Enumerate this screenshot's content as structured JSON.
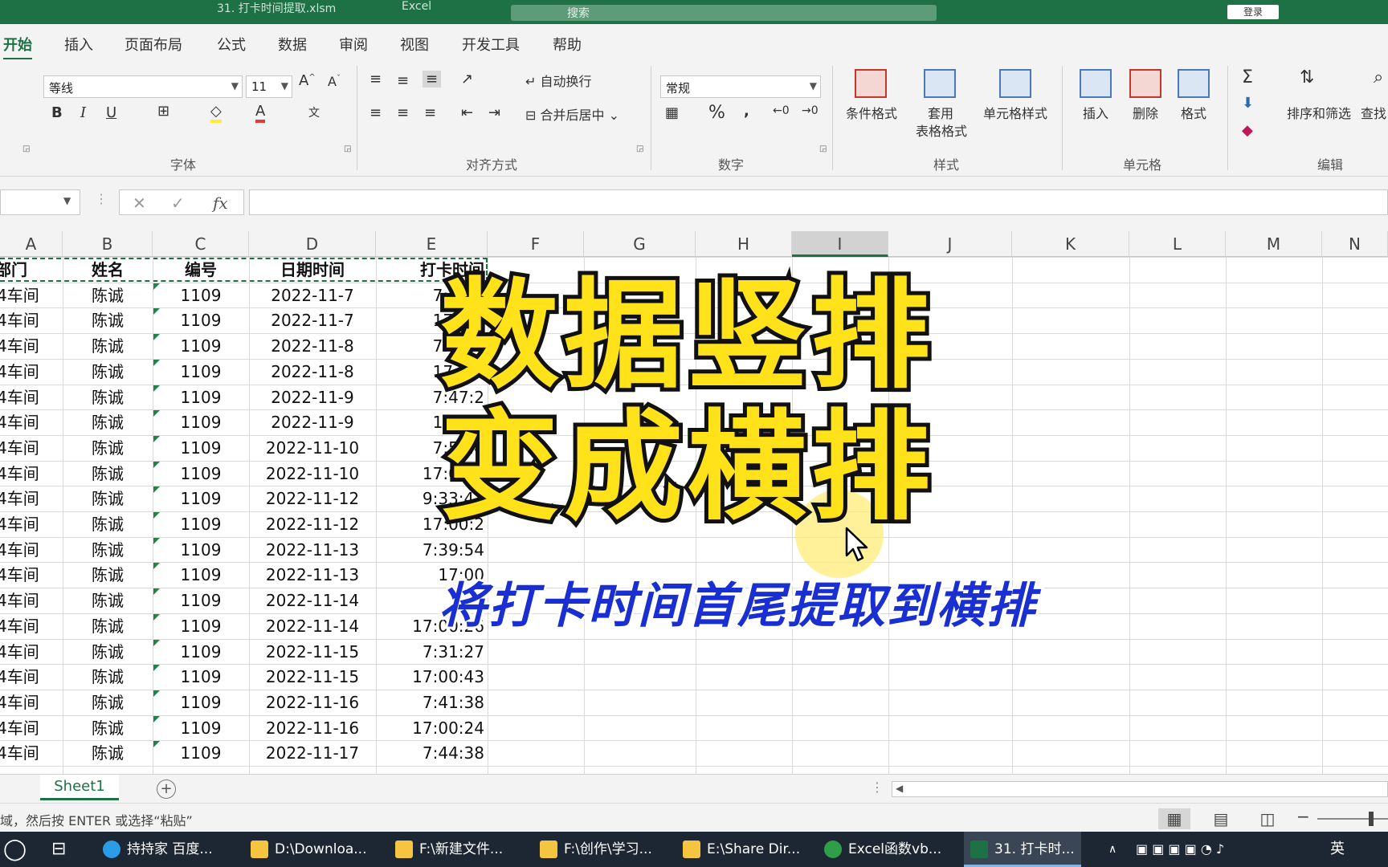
{
  "titlebar": {
    "filename": "31. 打卡时间提取.xlsm",
    "app": "Excel",
    "search": "搜索",
    "login": "登录"
  },
  "tabs": [
    "开始",
    "插入",
    "页面布局",
    "公式",
    "数据",
    "审阅",
    "视图",
    "开发工具",
    "帮助"
  ],
  "ribbon": {
    "font": {
      "name": "等线",
      "size": "11",
      "group_label": "字体"
    },
    "align": {
      "wrap": "自动换行",
      "merge": "合并后居中",
      "group_label": "对齐方式"
    },
    "number": {
      "format": "常规",
      "group_label": "数字"
    },
    "styles": {
      "cond": "条件格式",
      "table_1": "套用",
      "table_2": "表格格式",
      "cell_style": "单元格样式",
      "group_label": "样式"
    },
    "cells": {
      "insert": "插入",
      "delete": "删除",
      "format": "格式",
      "group_label": "单元格"
    },
    "editing": {
      "sort": "排序和筛选",
      "find": "查找",
      "group_label": "编辑"
    }
  },
  "formula_bar": {
    "cancel": "✕",
    "enter": "✓",
    "fx": "fx",
    "value": ""
  },
  "columns": [
    "A",
    "B",
    "C",
    "D",
    "E",
    "F",
    "G",
    "H",
    "I",
    "J",
    "K",
    "L",
    "M",
    "N"
  ],
  "table": {
    "headers": [
      "部门",
      "姓名",
      "编号",
      "日期时间",
      "打卡时间"
    ],
    "rows": [
      [
        "4车间",
        "陈诚",
        "1109",
        "2022-11-7",
        "7:52:3"
      ],
      [
        "4车间",
        "陈诚",
        "1109",
        "2022-11-7",
        "17:00:"
      ],
      [
        "4车间",
        "陈诚",
        "1109",
        "2022-11-8",
        "7:05:0"
      ],
      [
        "4车间",
        "陈诚",
        "1109",
        "2022-11-8",
        "17:09:"
      ],
      [
        "4车间",
        "陈诚",
        "1109",
        "2022-11-9",
        "7:47:2"
      ],
      [
        "4车间",
        "陈诚",
        "1109",
        "2022-11-9",
        "17:03:"
      ],
      [
        "4车间",
        "陈诚",
        "1109",
        "2022-11-10",
        "7:52:4"
      ],
      [
        "4车间",
        "陈诚",
        "1109",
        "2022-11-10",
        "17:01:1"
      ],
      [
        "4车间",
        "陈诚",
        "1109",
        "2022-11-12",
        "9:33:43"
      ],
      [
        "4车间",
        "陈诚",
        "1109",
        "2022-11-12",
        "17:00:2"
      ],
      [
        "4车间",
        "陈诚",
        "1109",
        "2022-11-13",
        "7:39:54"
      ],
      [
        "4车间",
        "陈诚",
        "1109",
        "2022-11-13",
        "17:00"
      ],
      [
        "4车间",
        "陈诚",
        "1109",
        "2022-11-14",
        "7:26"
      ],
      [
        "4车间",
        "陈诚",
        "1109",
        "2022-11-14",
        "17:00:26"
      ],
      [
        "4车间",
        "陈诚",
        "1109",
        "2022-11-15",
        "7:31:27"
      ],
      [
        "4车间",
        "陈诚",
        "1109",
        "2022-11-15",
        "17:00:43"
      ],
      [
        "4车间",
        "陈诚",
        "1109",
        "2022-11-16",
        "7:41:38"
      ],
      [
        "4车间",
        "陈诚",
        "1109",
        "2022-11-16",
        "17:00:24"
      ],
      [
        "4车间",
        "陈诚",
        "1109",
        "2022-11-17",
        "7:44:38"
      ]
    ]
  },
  "overlay": {
    "line1": "数据竖排",
    "line2": "变成横排",
    "subtitle": "将打卡时间首尾提取到横排"
  },
  "sheets": {
    "active": "Sheet1",
    "add": "+"
  },
  "status": {
    "message": "域，然后按 ENTER 或选择“粘贴”"
  },
  "taskbar": {
    "items": [
      "持持家 百度...",
      "D:\\Downloa...",
      "F:\\新建文件...",
      "F:\\创作\\学习...",
      "E:\\Share Dir...",
      "Excel函数vb...",
      "31. 打卡时..."
    ],
    "ime": "英"
  },
  "colors": {
    "excel_green": "#1e7145",
    "title_yellow": "#ffe21a",
    "subtitle_blue": "#1a2fd1"
  }
}
